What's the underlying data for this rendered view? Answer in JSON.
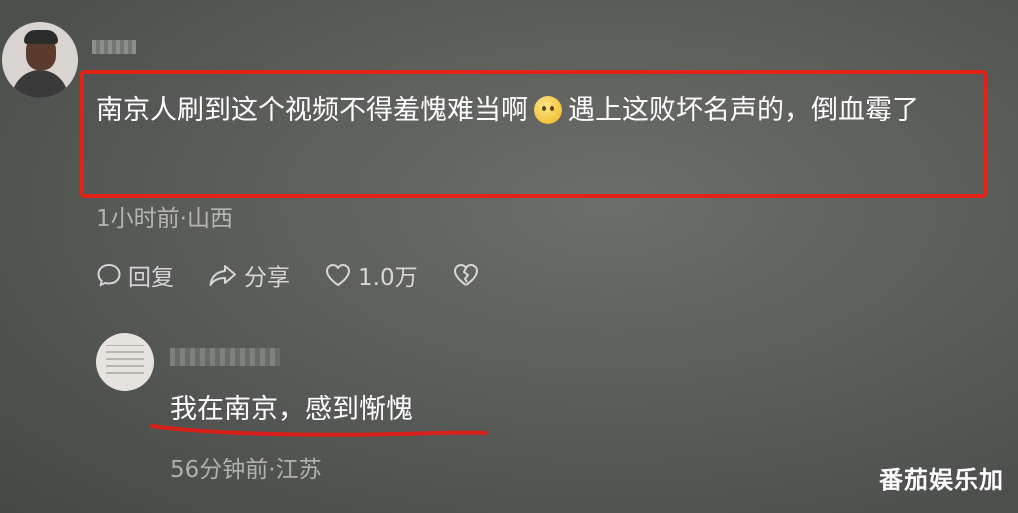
{
  "comment": {
    "text_before_emoji": "南京人刷到这个视频不得羞愧难当啊",
    "emoji_icon": "worried-face-emoji",
    "text_after_emoji": "遇上这败坏名声的，倒血霉了",
    "meta": "1小时前·山西",
    "actions": {
      "reply_label": "回复",
      "share_label": "分享",
      "like_count": "1.0万"
    },
    "highlight_color": "#e2231a"
  },
  "reply": {
    "text": "我在南京，感到惭愧",
    "meta": "56分钟前·江苏",
    "underline_color": "#d8201a"
  },
  "watermark": "番茄娱乐加"
}
